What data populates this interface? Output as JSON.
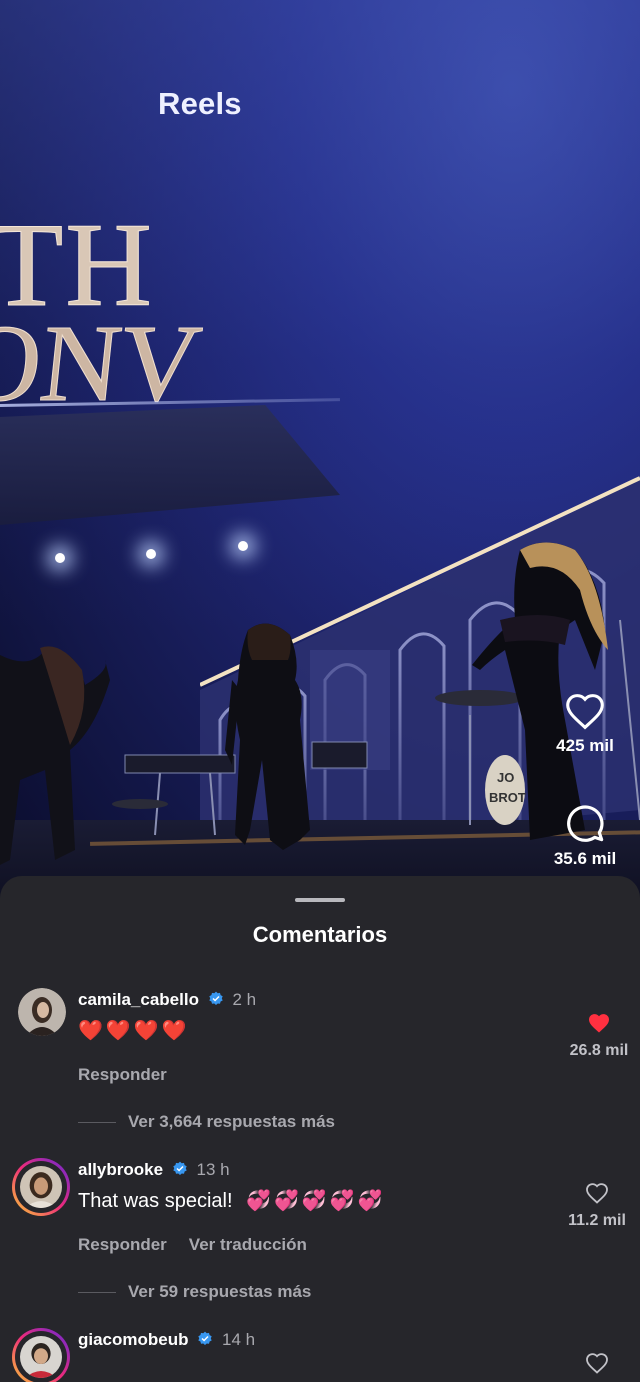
{
  "header": {
    "title": "Reels"
  },
  "reel_actions": {
    "likes": {
      "icon": "heart-outline-icon",
      "count": "425 mil"
    },
    "comments": {
      "icon": "comment-bubble-icon",
      "count": "35.6 mil"
    }
  },
  "video": {
    "stage_sign_line1": "TH",
    "stage_sign_line2": "ONV",
    "drum_text_line1": "JO",
    "drum_text_line2": "BROT"
  },
  "comments_sheet": {
    "title": "Comentarios",
    "comments": [
      {
        "username": "camila_cabello",
        "verified": true,
        "time": "2 h",
        "text": "❤️❤️❤️❤️",
        "reply_label": "Responder",
        "like_count": "26.8 mil",
        "liked": true,
        "view_replies": "Ver 3,664 respuestas más"
      },
      {
        "username": "allybrooke",
        "verified": true,
        "time": "13 h",
        "text": "That was special!",
        "emoji": "💞💞💞💞💞",
        "reply_label": "Responder",
        "translate_label": "Ver traducción",
        "like_count": "11.2 mil",
        "liked": false,
        "view_replies": "Ver 59 respuestas más"
      },
      {
        "username": "giacomobeub",
        "verified": true,
        "time": "14 h",
        "liked": false
      }
    ]
  },
  "colors": {
    "sheet_bg": "#26262b",
    "verified_blue": "#3897f0",
    "like_red": "#ff3040",
    "muted_text": "#a8a8ae"
  }
}
